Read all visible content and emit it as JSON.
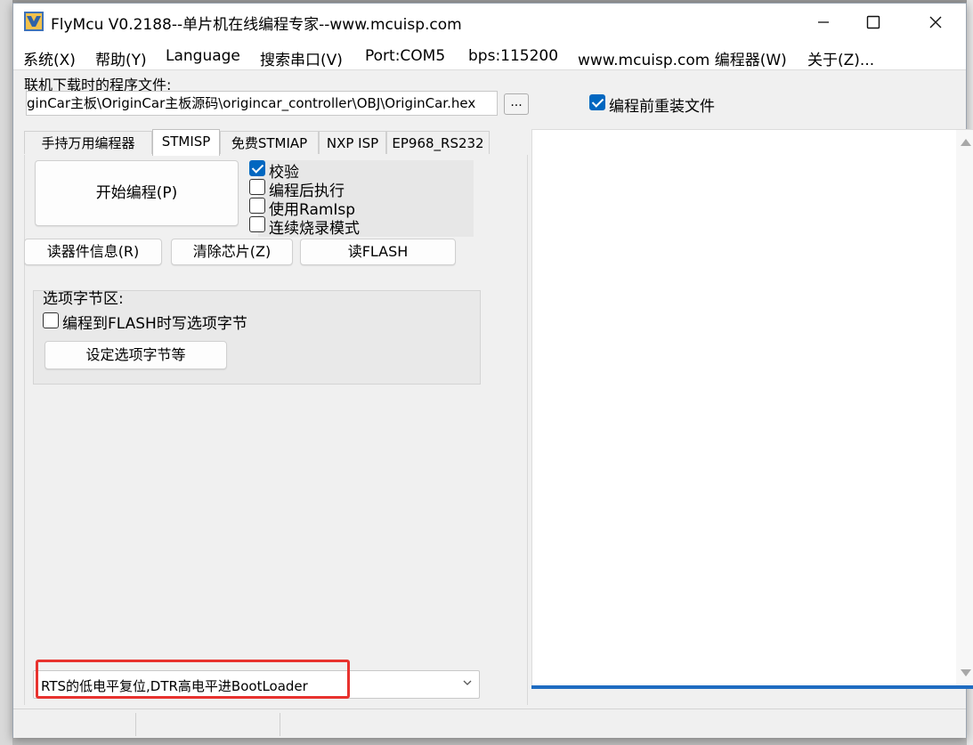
{
  "window": {
    "title": "FlyMcu V0.2188--单片机在线编程专家--www.mcuisp.com"
  },
  "menu": {
    "items": [
      "系统(X)",
      "帮助(Y)",
      "Language",
      "搜索串口(V)",
      "Port:COM5",
      "bps:115200",
      "www.mcuisp.com 编程器(W)",
      "关于(Z)..."
    ]
  },
  "file": {
    "label": "联机下载时的程序文件:",
    "path": "ginCar主板\\OriginCar主板源码\\origincar_controller\\OBJ\\OriginCar.hex",
    "browse_label": "...",
    "reload_checkbox": {
      "label": "编程前重装文件",
      "checked": true
    }
  },
  "tabs": {
    "items": [
      "手持万用编程器",
      "STMISP",
      "免费STMIAP",
      "NXP ISP",
      "EP968_RS232"
    ],
    "active": "STMISP"
  },
  "stmisp": {
    "start_button": "开始编程(P)",
    "checkboxes": [
      {
        "label": "校验",
        "checked": true
      },
      {
        "label": "编程后执行",
        "checked": false
      },
      {
        "label": "使用RamIsp",
        "checked": false
      },
      {
        "label": "连续烧录模式",
        "checked": false
      }
    ],
    "read_info_button": "读器件信息(R)",
    "erase_button": "清除芯片(Z)",
    "read_flash_button": "读FLASH",
    "option_group": {
      "title": "选项字节区:",
      "write_option_checkbox": {
        "label": "编程到FLASH时写选项字节",
        "checked": false
      },
      "set_option_button": "设定选项字节等"
    },
    "boot_mode_select": {
      "selected": "RTS的低电平复位,DTR高电平进BootLoader"
    }
  },
  "output": {
    "text": "",
    "progress_fraction": 1.0
  },
  "colors": {
    "accent": "#0067c0",
    "highlight_box": "#e8322e",
    "progress": "#1f6cc1"
  },
  "icons": {
    "app": "flymcu-app-icon",
    "minimize": "minimize-icon",
    "maximize": "maximize-icon",
    "close": "close-icon"
  }
}
